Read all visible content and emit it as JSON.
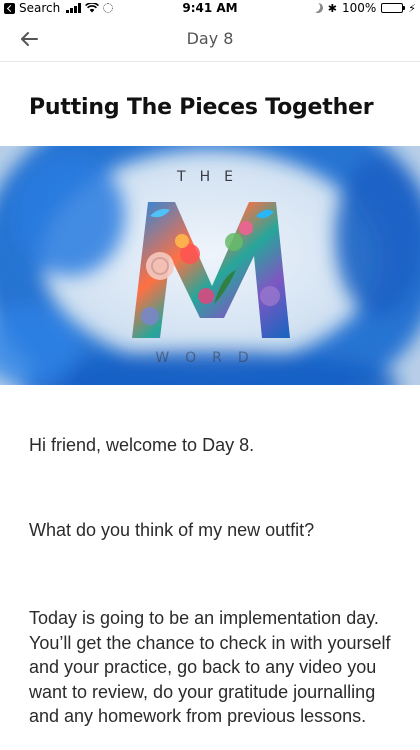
{
  "status_bar": {
    "back_app": "Search",
    "time": "9:41 AM",
    "battery": "100%",
    "icons": [
      "back-app-icon",
      "signal-icon",
      "wifi-icon",
      "loading-icon",
      "moon-icon",
      "bluetooth-icon",
      "battery-icon",
      "charging-icon"
    ]
  },
  "nav": {
    "title": "Day 8",
    "back_icon": "arrow-left-icon"
  },
  "page": {
    "title": "Putting The Pieces Together"
  },
  "hero": {
    "top_text": "THE",
    "letter": "M",
    "bottom_text": "WORD"
  },
  "body": {
    "paragraphs": [
      "Hi friend, welcome to Day 8.",
      "What do you think of my new outfit?",
      "Today is going to be an implementation day. You’ll get the chance to check in with yourself and your practice, go back to any video you want to review, do your gratitude journalling and any homework from previous lessons."
    ]
  },
  "colors": {
    "hero_ring": "#1f6fd1",
    "hero_bg": "#d6e4f2",
    "text": "#2b2b2b"
  }
}
